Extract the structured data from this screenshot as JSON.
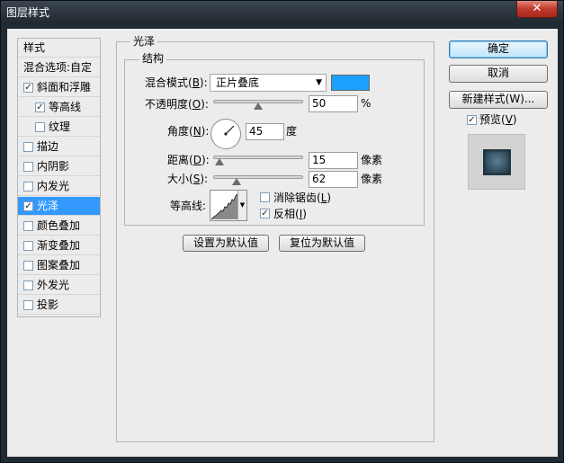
{
  "window": {
    "title": "图层样式",
    "close_glyph": "✕"
  },
  "stylelist": {
    "items": [
      {
        "label": "样式",
        "checkbox": false,
        "checked": false,
        "selected": false
      },
      {
        "label": "混合选项:自定",
        "checkbox": false,
        "checked": false,
        "selected": false
      },
      {
        "label": "斜面和浮雕",
        "checkbox": true,
        "checked": true,
        "selected": false
      },
      {
        "label": "等高线",
        "checkbox": true,
        "checked": true,
        "selected": false
      },
      {
        "label": "纹理",
        "checkbox": true,
        "checked": false,
        "selected": false
      },
      {
        "label": "描边",
        "checkbox": true,
        "checked": false,
        "selected": false
      },
      {
        "label": "内阴影",
        "checkbox": true,
        "checked": false,
        "selected": false
      },
      {
        "label": "内发光",
        "checkbox": true,
        "checked": false,
        "selected": false
      },
      {
        "label": "光泽",
        "checkbox": true,
        "checked": true,
        "selected": true
      },
      {
        "label": "颜色叠加",
        "checkbox": true,
        "checked": false,
        "selected": false
      },
      {
        "label": "渐变叠加",
        "checkbox": true,
        "checked": false,
        "selected": false
      },
      {
        "label": "图案叠加",
        "checkbox": true,
        "checked": false,
        "selected": false
      },
      {
        "label": "外发光",
        "checkbox": true,
        "checked": false,
        "selected": false
      },
      {
        "label": "投影",
        "checkbox": true,
        "checked": false,
        "selected": false
      }
    ]
  },
  "panel": {
    "group_title": "光泽",
    "subgroup_title": "结构",
    "blend_mode": {
      "label": "混合模式(",
      "mnemonic": "B",
      "label_end": "):",
      "value": "正片叠底",
      "color": "#1ea0ff"
    },
    "opacity": {
      "label": "不透明度(",
      "mnemonic": "O",
      "label_end": "):",
      "value": "50",
      "unit": "%",
      "level": 0.5
    },
    "angle": {
      "label": "角度(",
      "mnemonic": "N",
      "label_end": "):",
      "value": "45",
      "unit": "度"
    },
    "distance": {
      "label": "距离(",
      "mnemonic": "D",
      "label_end": "):",
      "value": "15",
      "unit": "像素",
      "level": 0.06
    },
    "size": {
      "label": "大小(",
      "mnemonic": "S",
      "label_end": "):",
      "value": "62",
      "unit": "像素",
      "level": 0.25
    },
    "contour": {
      "label": "等高线:"
    },
    "antialias": {
      "label": "消除锯齿(",
      "mnemonic": "L",
      "label_end": ")",
      "checked": false
    },
    "invert": {
      "label": "反相(",
      "mnemonic": "I",
      "label_end": ")",
      "checked": true
    },
    "set_default": "设置为默认值",
    "reset_default": "复位为默认值"
  },
  "actions": {
    "ok": "确定",
    "cancel": "取消",
    "new_style": "新建样式(W)...",
    "preview": {
      "label": "预览(",
      "mnemonic": "V",
      "label_end": ")",
      "checked": true
    }
  }
}
